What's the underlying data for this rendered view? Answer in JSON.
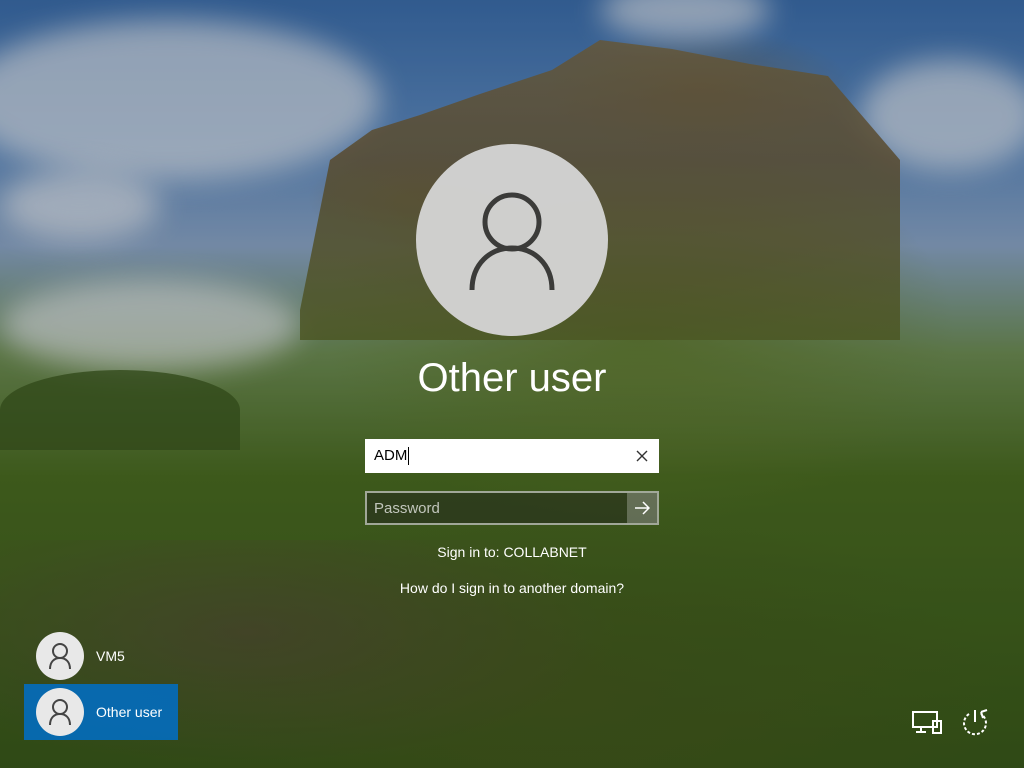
{
  "login": {
    "display_name": "Other user",
    "username_value": "ADM",
    "password_placeholder": "Password",
    "sign_in_to": "Sign in to: COLLABNET",
    "domain_help_link": "How do I sign in to another domain?"
  },
  "user_list": [
    {
      "name": "VM5",
      "selected": false
    },
    {
      "name": "Other user",
      "selected": true
    }
  ],
  "icons": {
    "avatar": "person-icon",
    "clear": "close-icon",
    "submit": "arrow-right-icon",
    "network": "network-icon",
    "power": "power-icon"
  },
  "colors": {
    "selected_tile": "#006ec8",
    "text": "#ffffff",
    "input_bg": "#ffffff"
  }
}
